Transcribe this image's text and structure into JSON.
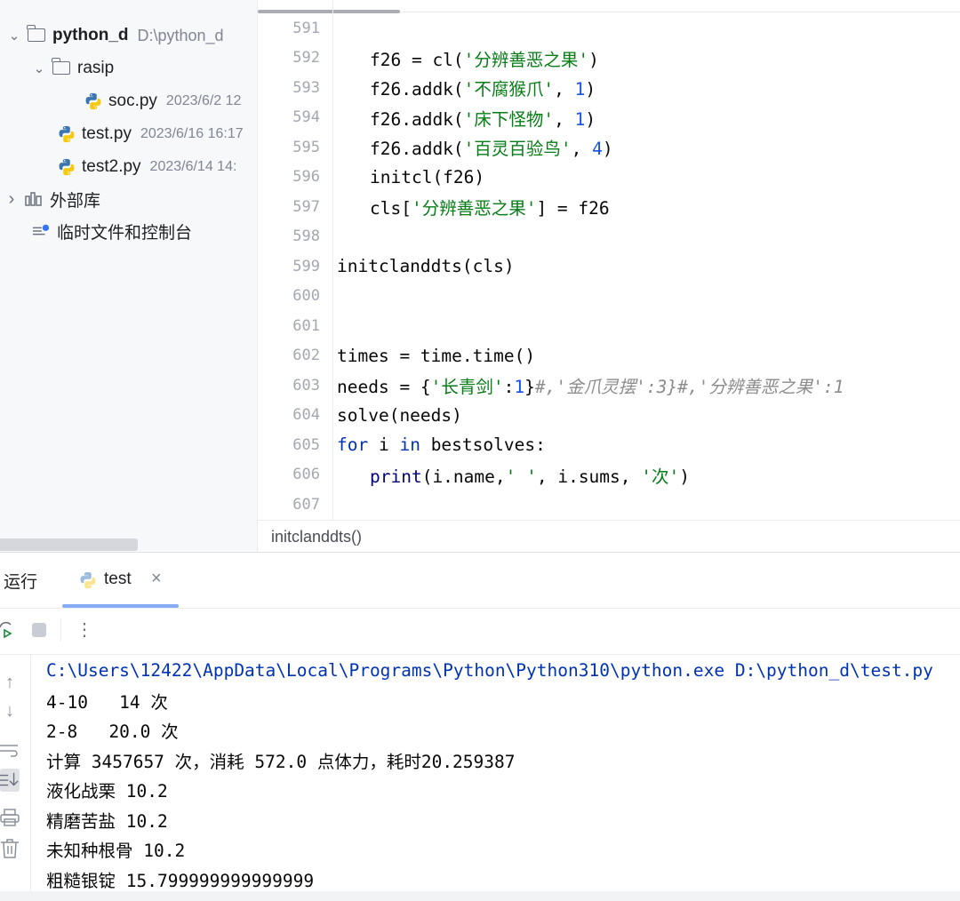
{
  "tree": {
    "project": {
      "name": "python_d",
      "path": "D:\\python_d"
    },
    "folder": {
      "name": "rasip"
    },
    "files": [
      {
        "name": "soc.py",
        "meta": "2023/6/2 12"
      },
      {
        "name": "test.py",
        "meta": "2023/6/16 16:17"
      },
      {
        "name": "test2.py",
        "meta": "2023/6/14 14:"
      }
    ],
    "external_libs": "外部库",
    "scratches": "临时文件和控制台"
  },
  "editor": {
    "line_numbers": [
      "591",
      "592",
      "593",
      "594",
      "595",
      "596",
      "597",
      "598",
      "599",
      "600",
      "601",
      "602",
      "603",
      "604",
      "605",
      "606",
      "607"
    ],
    "code": {
      "l592": {
        "pre": "f26 = cl(",
        "str": "'分辨善恶之果'",
        "post": ")"
      },
      "l593": {
        "pre": "f26.addk(",
        "str": "'不腐猴爪'",
        "mid": ", ",
        "num": "1",
        "post": ")"
      },
      "l594": {
        "pre": "f26.addk(",
        "str": "'床下怪物'",
        "mid": ", ",
        "num": "1",
        "post": ")"
      },
      "l595": {
        "pre": "f26.addk(",
        "str": "'百灵百验鸟'",
        "mid": ", ",
        "num": "4",
        "post": ")"
      },
      "l596": "initcl(f26)",
      "l597": {
        "pre": "cls[",
        "str": "'分辨善恶之果'",
        "post": "] = f26"
      },
      "l599": "initclanddts(cls)",
      "l602": "times = time.time()",
      "l603": {
        "pre": "needs = {",
        "str": "'长青剑'",
        "colon": ":",
        "num": "1",
        "close": "}",
        "comment": "#,'金爪灵摆':3}#,'分辨善恶之果':1"
      },
      "l604": "solve(needs)",
      "l605": {
        "kw1": "for",
        "mid1": " i ",
        "kw2": "in",
        "post": " bestsolves:"
      },
      "l606": {
        "fn": "print",
        "pre": "(i.name,",
        "str1": "' '",
        "mid": ", i.sums, ",
        "str2": "'次'",
        "post": ")"
      }
    },
    "breadcrumb": "initclanddts()"
  },
  "run": {
    "label": "运行",
    "tab": "test",
    "close_symbol": "×",
    "output": [
      "C:\\Users\\12422\\AppData\\Local\\Programs\\Python\\Python310\\python.exe D:\\python_d\\test.py",
      "4-10   14 次",
      "2-8   20.0 次",
      "计算 3457657 次，消耗 572.0 点体力，耗时20.259387",
      "液化战栗 10.2",
      "精磨苦盐 10.2",
      "未知种根骨 10.2",
      "粗糙银锭 15.799999999999999"
    ]
  },
  "icons": {
    "chevron_down": "⌄",
    "chevron_right": "›",
    "more": "⋮",
    "up": "↑",
    "down": "↓"
  },
  "colors": {
    "string": "#067d17",
    "number": "#1750eb",
    "keyword": "#0033b3",
    "comment": "#8c8c8c"
  }
}
